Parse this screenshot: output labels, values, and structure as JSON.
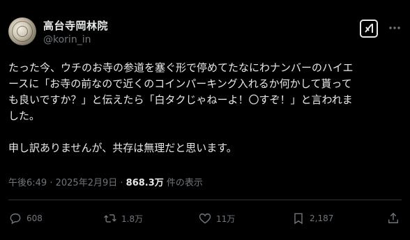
{
  "author": {
    "display_name": "高台寺岡林院",
    "handle": "@korin_in"
  },
  "post": {
    "lines": [
      "たった今、ウチのお寺の参道を塞ぐ形で停めてたなにわナンバーのハイエ",
      "ースに「お寺の前なので近くのコインパーキング入れるか何かして貰って",
      "も良いですか？」と伝えたら「白タクじゃねーよ！〇すぞ！」と言われま",
      "した。"
    ],
    "second_paragraph": "申し訳ありませんが、共存は無理だと思います。"
  },
  "meta": {
    "time": "午後6:49",
    "sep1": " · ",
    "date": "2025年2月9日",
    "sep2": " · ",
    "views": "868.3万",
    "views_label": " 件の表示"
  },
  "actions": {
    "reply_count": "608",
    "repost_count": "1.8万",
    "like_count": "11万",
    "bookmark_count": "2,187"
  },
  "icons": {
    "reply": "speech-bubble-icon",
    "repost": "repost-icon",
    "like": "heart-icon",
    "bookmark": "bookmark-icon",
    "share": "share-icon",
    "grok": "grok-icon",
    "more": "more-dots-icon"
  },
  "colors": {
    "background": "#000000",
    "text": "#e7e9ea",
    "secondary": "#71767b",
    "divider": "#2f3336"
  }
}
